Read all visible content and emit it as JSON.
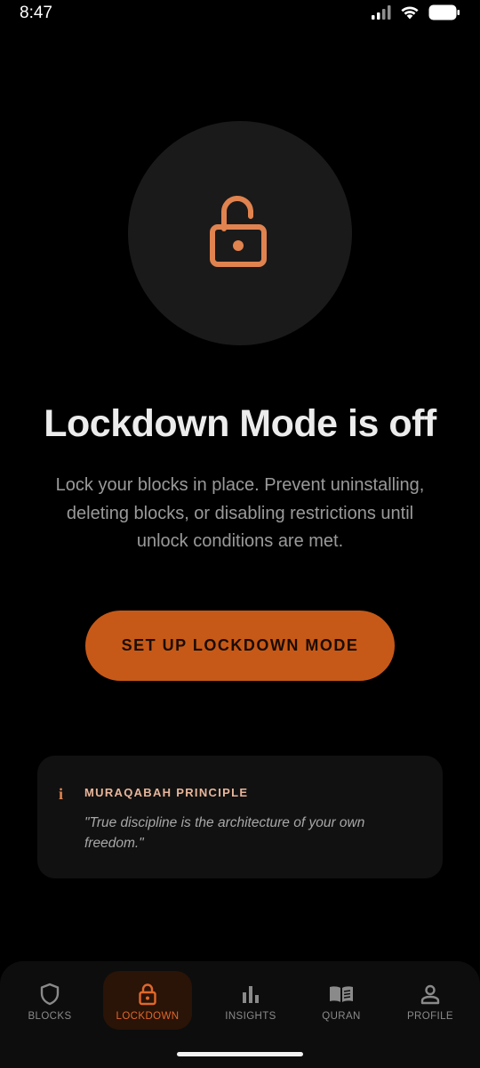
{
  "status_bar": {
    "time": "8:47",
    "icons": [
      "signal-icon",
      "wifi-icon",
      "battery-icon"
    ]
  },
  "lock_icon": "unlocked-padlock-icon",
  "headline": "Lockdown Mode is off",
  "description": "Lock your blocks in place. Prevent uninstalling, deleting blocks, or disabling restrictions until unlock conditions are met.",
  "setup_button_label": "SET UP LOCKDOWN MODE",
  "principle": {
    "icon_glyph": "i",
    "title": "MURAQABAH PRINCIPLE",
    "quote": "\"True discipline is the architecture of your own freedom.\""
  },
  "nav": {
    "items": [
      {
        "label": "BLOCKS",
        "icon": "shield-icon",
        "active": false
      },
      {
        "label": "LOCKDOWN",
        "icon": "lock-icon",
        "active": true
      },
      {
        "label": "INSIGHTS",
        "icon": "bar-chart-icon",
        "active": false
      },
      {
        "label": "QURAN",
        "icon": "open-book-icon",
        "active": false
      },
      {
        "label": "PROFILE",
        "icon": "person-icon",
        "active": false
      }
    ]
  },
  "colors": {
    "accent": "#c75918",
    "accent_light": "#e0834f",
    "background": "#000000",
    "surface": "#1a1a1a",
    "card": "#111111"
  }
}
